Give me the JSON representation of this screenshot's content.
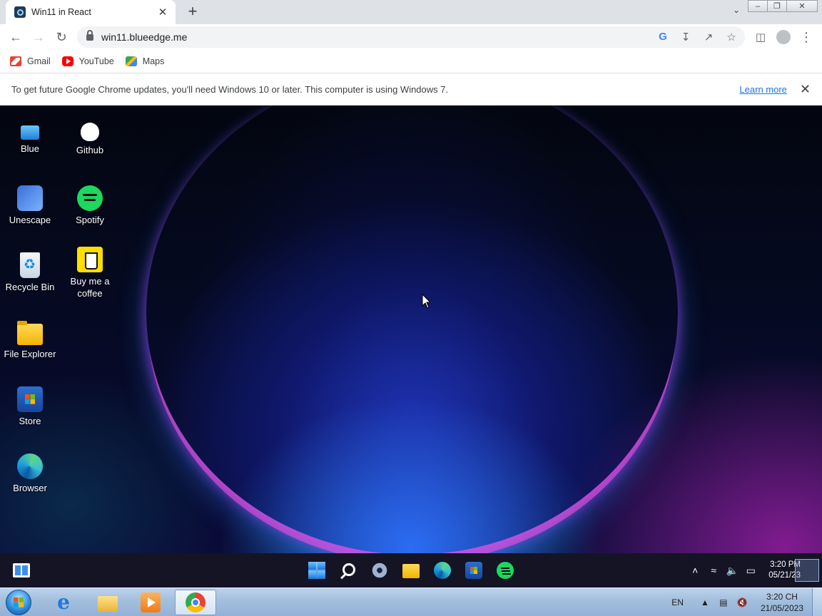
{
  "browser": {
    "tab_title": "Win11 in React",
    "url": "win11.blueedge.me",
    "bookmarks": [
      {
        "label": "Gmail",
        "icon": "gmail-icon"
      },
      {
        "label": "YouTube",
        "icon": "youtube-icon"
      },
      {
        "label": "Maps",
        "icon": "maps-icon"
      }
    ],
    "infobar": {
      "message": "To get future Google Chrome updates, you'll need Windows 10 or later. This computer is using Windows 7.",
      "link": "Learn more"
    }
  },
  "desktop": {
    "icons": [
      {
        "label": "Blue",
        "icon": "blue-user-icon"
      },
      {
        "label": "Github",
        "icon": "github-icon"
      },
      {
        "label": "Unescape",
        "icon": "unescape-icon"
      },
      {
        "label": "Spotify",
        "icon": "spotify-icon"
      },
      {
        "label": "Recycle Bin",
        "icon": "recycle-bin-icon"
      },
      {
        "label": "Buy me a coffee",
        "icon": "coffee-icon"
      },
      {
        "label": "File Explorer",
        "icon": "folder-icon"
      },
      {
        "label": "Store",
        "icon": "store-icon"
      },
      {
        "label": "Browser",
        "icon": "edge-icon"
      }
    ]
  },
  "win11_taskbar": {
    "apps": [
      "start-icon",
      "search-icon",
      "settings-icon",
      "file-explorer-icon",
      "edge-icon",
      "store-icon",
      "spotify-icon"
    ],
    "clock_time": "3:20 PM",
    "clock_date": "05/21/23"
  },
  "win7_taskbar": {
    "pinned": [
      "internet-explorer-icon",
      "windows-explorer-icon",
      "media-player-icon",
      "chrome-icon"
    ],
    "language": "EN",
    "clock_time": "3:20 CH",
    "clock_date": "21/05/2023"
  },
  "colors": {
    "chrome_tabstrip": "#dee1e6",
    "link_blue": "#1a73e8",
    "desktop_bg": "#050a22",
    "orb_glow": "#ff50dc"
  }
}
